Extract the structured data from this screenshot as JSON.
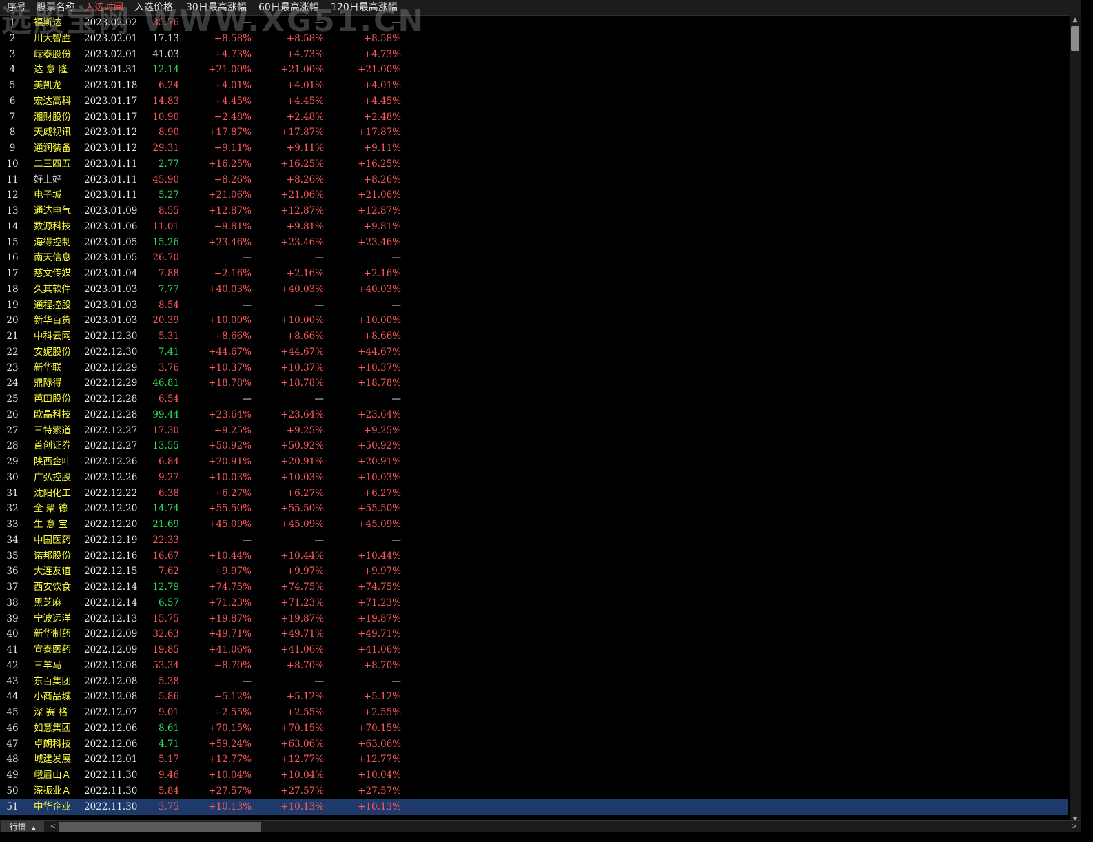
{
  "watermark": "选股宝网 WWW.XG51.CN",
  "headers": [
    "序号",
    "股票名称",
    "入选时间",
    "入选价格",
    "30日最高涨幅",
    "60日最高涨幅",
    "120日最高涨幅"
  ],
  "active_header": 2,
  "colors": {
    "name": "#ffff3c",
    "up": "#ff5a5a",
    "down": "#2ee05a",
    "neutral": "#e6e6e6",
    "selected_row": "#1e3a6a"
  },
  "selected_index": 50,
  "rows": [
    {
      "idx": "1",
      "name": "福斯达",
      "date": "2023.02.02",
      "price": "35.76",
      "dir": "up",
      "g30": "—",
      "g60": "—",
      "g120": "—"
    },
    {
      "idx": "2",
      "name": "川大智胜",
      "date": "2023.02.01",
      "price": "17.13",
      "dir": "flat",
      "g30": "+8.58%",
      "g60": "+8.58%",
      "g120": "+8.58%"
    },
    {
      "idx": "3",
      "name": "嵘泰股份",
      "date": "2023.02.01",
      "price": "41.03",
      "dir": "flat",
      "g30": "+4.73%",
      "g60": "+4.73%",
      "g120": "+4.73%"
    },
    {
      "idx": "4",
      "name": "达 意 隆",
      "date": "2023.01.31",
      "price": "12.14",
      "dir": "down",
      "g30": "+21.00%",
      "g60": "+21.00%",
      "g120": "+21.00%"
    },
    {
      "idx": "5",
      "name": "美凯龙",
      "date": "2023.01.18",
      "price": "6.24",
      "dir": "up",
      "g30": "+4.01%",
      "g60": "+4.01%",
      "g120": "+4.01%"
    },
    {
      "idx": "6",
      "name": "宏达高科",
      "date": "2023.01.17",
      "price": "14.83",
      "dir": "up",
      "g30": "+4.45%",
      "g60": "+4.45%",
      "g120": "+4.45%"
    },
    {
      "idx": "7",
      "name": "湘财股份",
      "date": "2023.01.17",
      "price": "10.90",
      "dir": "up",
      "g30": "+2.48%",
      "g60": "+2.48%",
      "g120": "+2.48%"
    },
    {
      "idx": "8",
      "name": "天威视讯",
      "date": "2023.01.12",
      "price": "8.90",
      "dir": "up",
      "g30": "+17.87%",
      "g60": "+17.87%",
      "g120": "+17.87%"
    },
    {
      "idx": "9",
      "name": "通润装备",
      "date": "2023.01.12",
      "price": "29.31",
      "dir": "up",
      "g30": "+9.11%",
      "g60": "+9.11%",
      "g120": "+9.11%"
    },
    {
      "idx": "10",
      "name": "二三四五",
      "date": "2023.01.11",
      "price": "2.77",
      "dir": "down",
      "g30": "+16.25%",
      "g60": "+16.25%",
      "g120": "+16.25%"
    },
    {
      "idx": "11",
      "name": "好上好",
      "date": "2023.01.11",
      "price": "45.90",
      "dir": "up",
      "g30": "+8.26%",
      "g60": "+8.26%",
      "g120": "+8.26%",
      "plain": true
    },
    {
      "idx": "12",
      "name": "电子城",
      "date": "2023.01.11",
      "price": "5.27",
      "dir": "down",
      "g30": "+21.06%",
      "g60": "+21.06%",
      "g120": "+21.06%"
    },
    {
      "idx": "13",
      "name": "通达电气",
      "date": "2023.01.09",
      "price": "8.55",
      "dir": "up",
      "g30": "+12.87%",
      "g60": "+12.87%",
      "g120": "+12.87%"
    },
    {
      "idx": "14",
      "name": "数源科技",
      "date": "2023.01.06",
      "price": "11.01",
      "dir": "up",
      "g30": "+9.81%",
      "g60": "+9.81%",
      "g120": "+9.81%"
    },
    {
      "idx": "15",
      "name": "海得控制",
      "date": "2023.01.05",
      "price": "15.26",
      "dir": "down",
      "g30": "+23.46%",
      "g60": "+23.46%",
      "g120": "+23.46%"
    },
    {
      "idx": "16",
      "name": "南天信息",
      "date": "2023.01.05",
      "price": "26.70",
      "dir": "up",
      "g30": "—",
      "g60": "—",
      "g120": "—"
    },
    {
      "idx": "17",
      "name": "慈文传媒",
      "date": "2023.01.04",
      "price": "7.88",
      "dir": "up",
      "g30": "+2.16%",
      "g60": "+2.16%",
      "g120": "+2.16%"
    },
    {
      "idx": "18",
      "name": "久其软件",
      "date": "2023.01.03",
      "price": "7.77",
      "dir": "down",
      "g30": "+40.03%",
      "g60": "+40.03%",
      "g120": "+40.03%"
    },
    {
      "idx": "19",
      "name": "通程控股",
      "date": "2023.01.03",
      "price": "8.54",
      "dir": "up",
      "g30": "—",
      "g60": "—",
      "g120": "—"
    },
    {
      "idx": "20",
      "name": "新华百货",
      "date": "2023.01.03",
      "price": "20.39",
      "dir": "up",
      "g30": "+10.00%",
      "g60": "+10.00%",
      "g120": "+10.00%"
    },
    {
      "idx": "21",
      "name": "中科云网",
      "date": "2022.12.30",
      "price": "5.31",
      "dir": "up",
      "g30": "+8.66%",
      "g60": "+8.66%",
      "g120": "+8.66%"
    },
    {
      "idx": "22",
      "name": "安妮股份",
      "date": "2022.12.30",
      "price": "7.41",
      "dir": "down",
      "g30": "+44.67%",
      "g60": "+44.67%",
      "g120": "+44.67%"
    },
    {
      "idx": "23",
      "name": "新华联",
      "date": "2022.12.29",
      "price": "3.76",
      "dir": "up",
      "g30": "+10.37%",
      "g60": "+10.37%",
      "g120": "+10.37%"
    },
    {
      "idx": "24",
      "name": "鼎际得",
      "date": "2022.12.29",
      "price": "46.81",
      "dir": "down",
      "g30": "+18.78%",
      "g60": "+18.78%",
      "g120": "+18.78%"
    },
    {
      "idx": "25",
      "name": "芭田股份",
      "date": "2022.12.28",
      "price": "6.54",
      "dir": "up",
      "g30": "—",
      "g60": "—",
      "g120": "—"
    },
    {
      "idx": "26",
      "name": "欧晶科技",
      "date": "2022.12.28",
      "price": "99.44",
      "dir": "down",
      "g30": "+23.64%",
      "g60": "+23.64%",
      "g120": "+23.64%"
    },
    {
      "idx": "27",
      "name": "三特索道",
      "date": "2022.12.27",
      "price": "17.30",
      "dir": "up",
      "g30": "+9.25%",
      "g60": "+9.25%",
      "g120": "+9.25%"
    },
    {
      "idx": "28",
      "name": "首创证券",
      "date": "2022.12.27",
      "price": "13.55",
      "dir": "down",
      "g30": "+50.92%",
      "g60": "+50.92%",
      "g120": "+50.92%"
    },
    {
      "idx": "29",
      "name": "陕西金叶",
      "date": "2022.12.26",
      "price": "6.84",
      "dir": "up",
      "g30": "+20.91%",
      "g60": "+20.91%",
      "g120": "+20.91%"
    },
    {
      "idx": "30",
      "name": "广弘控股",
      "date": "2022.12.26",
      "price": "9.27",
      "dir": "up",
      "g30": "+10.03%",
      "g60": "+10.03%",
      "g120": "+10.03%"
    },
    {
      "idx": "31",
      "name": "沈阳化工",
      "date": "2022.12.22",
      "price": "6.38",
      "dir": "up",
      "g30": "+6.27%",
      "g60": "+6.27%",
      "g120": "+6.27%"
    },
    {
      "idx": "32",
      "name": "全 聚 德",
      "date": "2022.12.20",
      "price": "14.74",
      "dir": "down",
      "g30": "+55.50%",
      "g60": "+55.50%",
      "g120": "+55.50%"
    },
    {
      "idx": "33",
      "name": "生 意 宝",
      "date": "2022.12.20",
      "price": "21.69",
      "dir": "down",
      "g30": "+45.09%",
      "g60": "+45.09%",
      "g120": "+45.09%"
    },
    {
      "idx": "34",
      "name": "中国医药",
      "date": "2022.12.19",
      "price": "22.33",
      "dir": "up",
      "g30": "—",
      "g60": "—",
      "g120": "—"
    },
    {
      "idx": "35",
      "name": "诺邦股份",
      "date": "2022.12.16",
      "price": "16.67",
      "dir": "up",
      "g30": "+10.44%",
      "g60": "+10.44%",
      "g120": "+10.44%"
    },
    {
      "idx": "36",
      "name": "大连友谊",
      "date": "2022.12.15",
      "price": "7.62",
      "dir": "up",
      "g30": "+9.97%",
      "g60": "+9.97%",
      "g120": "+9.97%"
    },
    {
      "idx": "37",
      "name": "西安饮食",
      "date": "2022.12.14",
      "price": "12.79",
      "dir": "down",
      "g30": "+74.75%",
      "g60": "+74.75%",
      "g120": "+74.75%"
    },
    {
      "idx": "38",
      "name": "黑芝麻",
      "date": "2022.12.14",
      "price": "6.57",
      "dir": "down",
      "g30": "+71.23%",
      "g60": "+71.23%",
      "g120": "+71.23%"
    },
    {
      "idx": "39",
      "name": "宁波远洋",
      "date": "2022.12.13",
      "price": "15.75",
      "dir": "up",
      "g30": "+19.87%",
      "g60": "+19.87%",
      "g120": "+19.87%"
    },
    {
      "idx": "40",
      "name": "新华制药",
      "date": "2022.12.09",
      "price": "32.63",
      "dir": "up",
      "g30": "+49.71%",
      "g60": "+49.71%",
      "g120": "+49.71%"
    },
    {
      "idx": "41",
      "name": "宣泰医药",
      "date": "2022.12.09",
      "price": "19.85",
      "dir": "up",
      "g30": "+41.06%",
      "g60": "+41.06%",
      "g120": "+41.06%"
    },
    {
      "idx": "42",
      "name": "三羊马",
      "date": "2022.12.08",
      "price": "53.34",
      "dir": "up",
      "g30": "+8.70%",
      "g60": "+8.70%",
      "g120": "+8.70%"
    },
    {
      "idx": "43",
      "name": "东百集团",
      "date": "2022.12.08",
      "price": "5.38",
      "dir": "up",
      "g30": "—",
      "g60": "—",
      "g120": "—"
    },
    {
      "idx": "44",
      "name": "小商品城",
      "date": "2022.12.08",
      "price": "5.86",
      "dir": "up",
      "g30": "+5.12%",
      "g60": "+5.12%",
      "g120": "+5.12%"
    },
    {
      "idx": "45",
      "name": "深 赛 格",
      "date": "2022.12.07",
      "price": "9.01",
      "dir": "up",
      "g30": "+2.55%",
      "g60": "+2.55%",
      "g120": "+2.55%"
    },
    {
      "idx": "46",
      "name": "如意集团",
      "date": "2022.12.06",
      "price": "8.61",
      "dir": "down",
      "g30": "+70.15%",
      "g60": "+70.15%",
      "g120": "+70.15%"
    },
    {
      "idx": "47",
      "name": "卓朗科技",
      "date": "2022.12.06",
      "price": "4.71",
      "dir": "down",
      "g30": "+59.24%",
      "g60": "+63.06%",
      "g120": "+63.06%"
    },
    {
      "idx": "48",
      "name": "城建发展",
      "date": "2022.12.01",
      "price": "5.17",
      "dir": "up",
      "g30": "+12.77%",
      "g60": "+12.77%",
      "g120": "+12.77%"
    },
    {
      "idx": "49",
      "name": "峨眉山Ａ",
      "date": "2022.11.30",
      "price": "9.46",
      "dir": "up",
      "g30": "+10.04%",
      "g60": "+10.04%",
      "g120": "+10.04%"
    },
    {
      "idx": "50",
      "name": "深振业Ａ",
      "date": "2022.11.30",
      "price": "5.84",
      "dir": "up",
      "g30": "+27.57%",
      "g60": "+27.57%",
      "g120": "+27.57%"
    },
    {
      "idx": "51",
      "name": "中华企业",
      "date": "2022.11.30",
      "price": "3.75",
      "dir": "up",
      "g30": "+10.13%",
      "g60": "+10.13%",
      "g120": "+10.13%"
    }
  ],
  "bottom_tab": "行情",
  "icons": {
    "tab_caret": "caret-up-icon",
    "scroll_left": "arrow-left-icon",
    "scroll_right": "arrow-right-icon",
    "scroll_up": "arrow-up-icon",
    "scroll_down": "arrow-down-icon"
  }
}
